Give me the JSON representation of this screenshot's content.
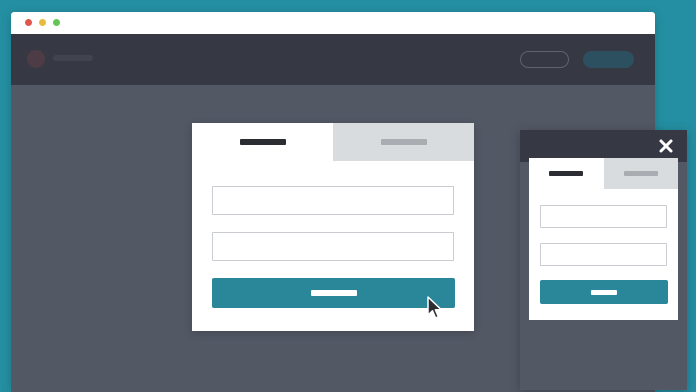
{
  "colors": {
    "page_background": "#248fa2",
    "browser_body": "#535865",
    "header_dark": "#363944",
    "accent_teal": "#2a8799",
    "inactive_tab": "#d9dcde",
    "window_dot_red": "#e0564d",
    "window_dot_yellow": "#e7bc3c",
    "window_dot_green": "#62c554"
  },
  "icons": {
    "close": "close-icon",
    "cursor": "mouse-pointer-icon"
  },
  "browser": {
    "window_controls": [
      "close",
      "minimize",
      "maximize"
    ]
  },
  "login_modal": {
    "tabs": [
      {
        "state": "active"
      },
      {
        "state": "inactive"
      }
    ],
    "fields": [
      "empty",
      "empty"
    ],
    "submit": "button"
  },
  "mobile_modal": {
    "tabs": [
      {
        "state": "active"
      },
      {
        "state": "inactive"
      }
    ],
    "fields": [
      "empty",
      "empty"
    ],
    "submit": "button"
  }
}
